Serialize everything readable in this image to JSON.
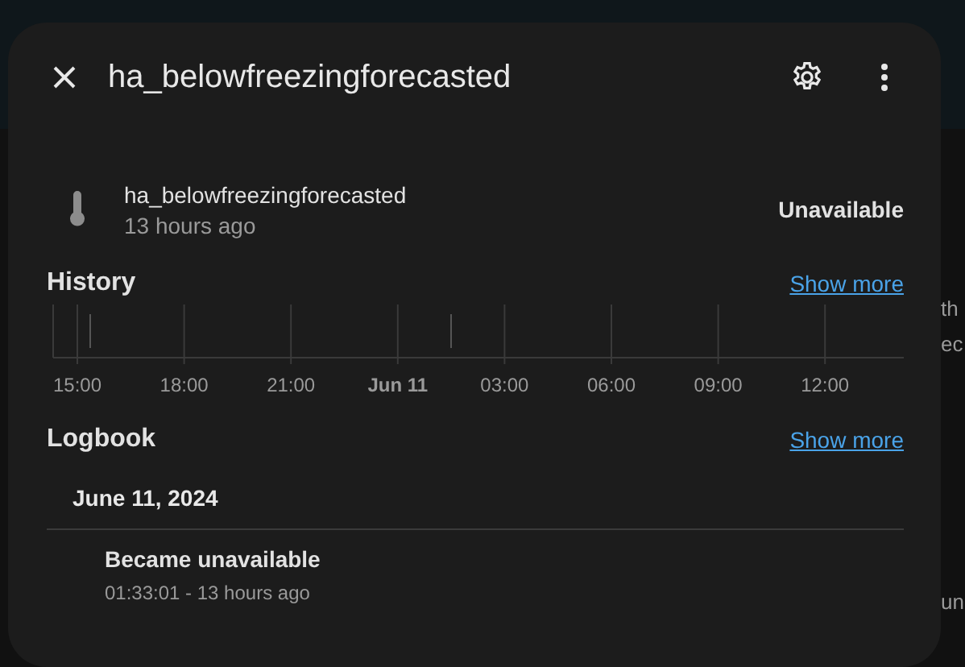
{
  "background_fragments": [
    {
      "text": "th"
    },
    {
      "text": "ec"
    },
    {
      "text": "un"
    }
  ],
  "dialog": {
    "title": "ha_belowfreezingforecasted"
  },
  "entity": {
    "name": "ha_belowfreezingforecasted",
    "changed": "13 hours ago",
    "state": "Unavailable"
  },
  "history": {
    "heading": "History",
    "link": "Show more",
    "axis_labels": [
      {
        "label": "15:00",
        "bold": false
      },
      {
        "label": "18:00",
        "bold": false
      },
      {
        "label": "21:00",
        "bold": false
      },
      {
        "label": "Jun 11",
        "bold": true
      },
      {
        "label": "03:00",
        "bold": false
      },
      {
        "label": "06:00",
        "bold": false
      },
      {
        "label": "09:00",
        "bold": false
      },
      {
        "label": "12:00",
        "bold": false
      }
    ]
  },
  "logbook": {
    "heading": "Logbook",
    "link": "Show more",
    "date": "June 11, 2024",
    "entries": [
      {
        "message": "Became unavailable",
        "time": "01:33:01 - 13 hours ago"
      }
    ]
  }
}
